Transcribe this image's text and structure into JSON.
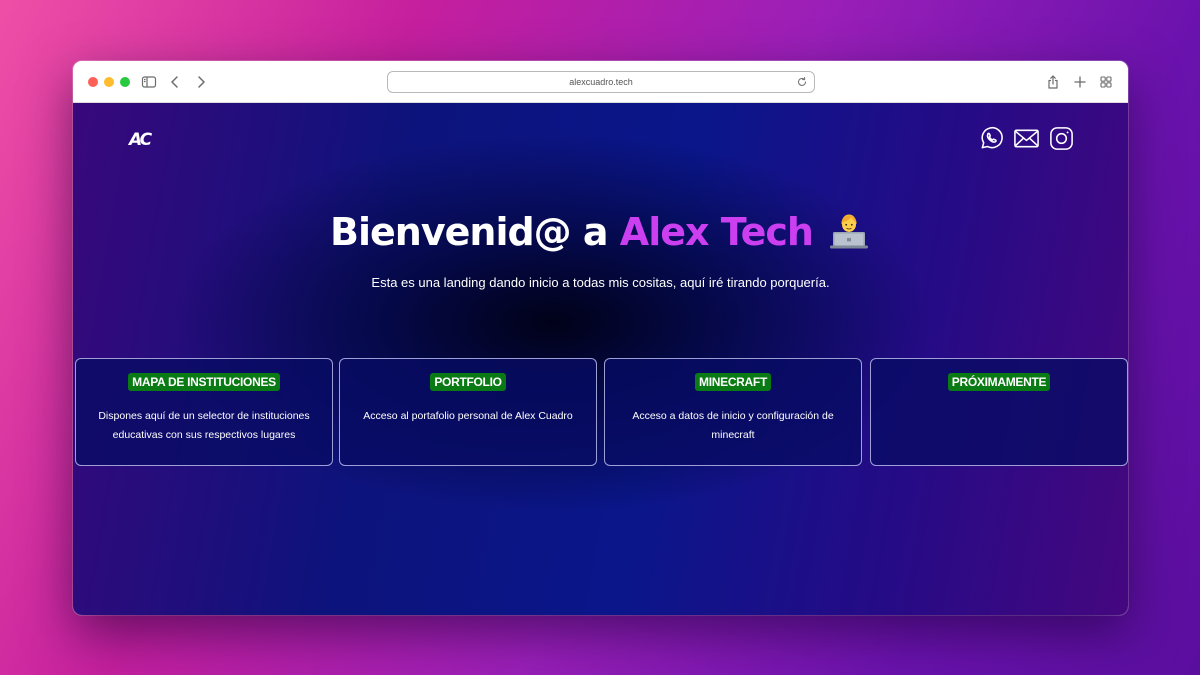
{
  "browser": {
    "url": "alexcuadro.tech"
  },
  "site": {
    "logo": "AC",
    "title_prefix": "Bienvenid@ a ",
    "title_accent": "Alex Tech",
    "subtitle": "Esta es una landing dando inicio a todas mis cositas, aquí iré tirando porquería.",
    "emoji": "technologist-emoji",
    "social_icons": [
      "whatsapp-icon",
      "mail-icon",
      "instagram-icon"
    ]
  },
  "cards": [
    {
      "title": "MAPA DE INSTITUCIONES",
      "description": "Dispones aquí de un selector de instituciones educativas con sus respectivos lugares"
    },
    {
      "title": "PORTFOLIO",
      "description": "Acceso al portafolio personal de Alex Cuadro"
    },
    {
      "title": "MINECRAFT",
      "description": "Acceso a datos de inicio y configuración de minecraft"
    },
    {
      "title": "PRÓXIMAMENTE",
      "description": ""
    }
  ],
  "colors": {
    "accent": "#cb3ff0",
    "badge_green": "#0a7a14",
    "page_blue": "#0a168a"
  }
}
